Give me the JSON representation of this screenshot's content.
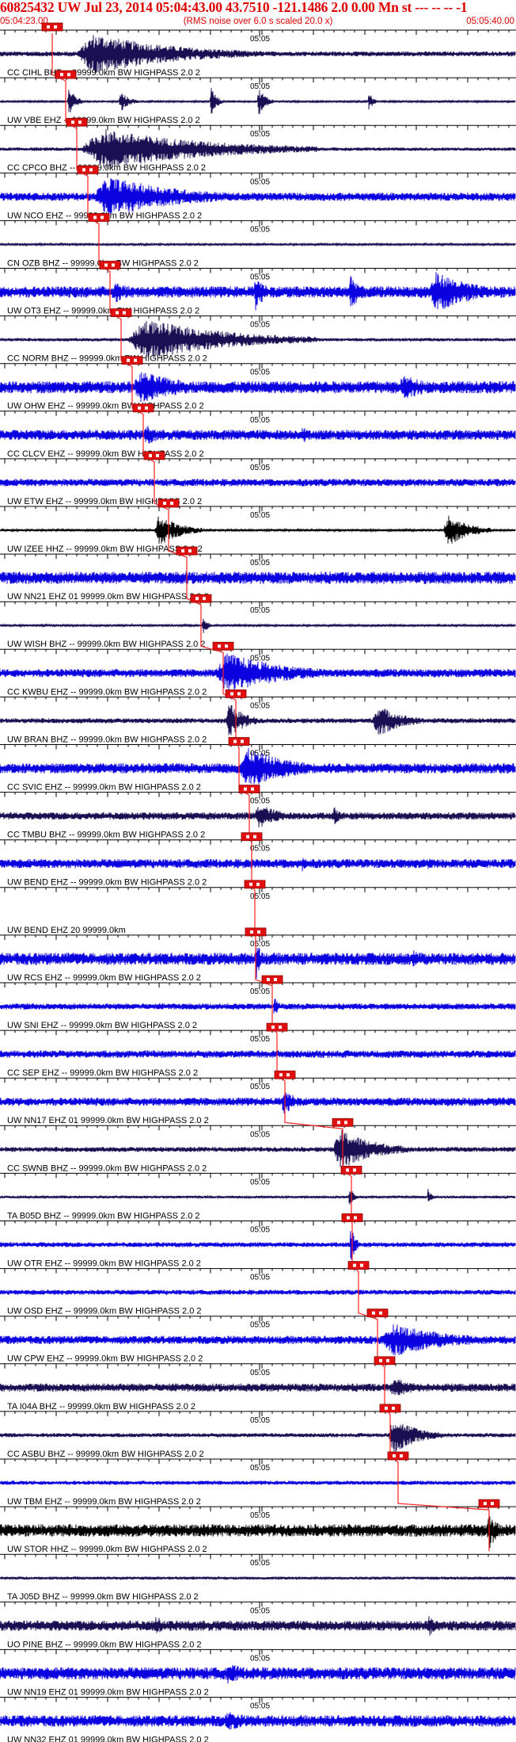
{
  "header": {
    "title": "60825432 UW Jul 23, 2014 05:04:43.00  43.7510 -121.1486  2.0 0.00 Mn st --- -- --  -1",
    "start_time": "05:04:23.00",
    "scaling_note": "(RMS noise over 6.0 s scaled 20.0 x)",
    "end_time": "05:05:40.00"
  },
  "colors": {
    "header_text": "#e00000",
    "pick_line": "#ff2020",
    "pick_box": "#e01010",
    "trace_dark": "#1a0f52",
    "trace_blue": "#0b00e0",
    "trace_black": "#000000",
    "axis": "#000000",
    "label_text": "#000000"
  },
  "chart_data": {
    "type": "seismogram",
    "title": "60825432 UW Jul 23, 2014 05:04:43.00  43.7510 -121.1486  2.0 0.00 Mn st --- -- --  -1",
    "x_start": "05:04:23.00",
    "x_end": "05:05:40.00",
    "x_tick_label": "05:05",
    "traces": [
      {
        "label": "CC CIHL BHZ -- 99999.0km BW  HIGHPASS  2.0  2",
        "color": "dark",
        "noise": 0.12,
        "pick": 66,
        "bursts": [
          [
            95,
            330,
            1.0
          ]
        ]
      },
      {
        "label": "UW VBE EHZ -- 99999.0km BW  HIGHPASS  2.0  2",
        "color": "dark",
        "noise": 0.04,
        "pick": 83,
        "bursts": [
          [
            85,
            105,
            0.7
          ],
          [
            150,
            175,
            0.5
          ],
          [
            265,
            280,
            0.8
          ],
          [
            325,
            345,
            0.7
          ],
          [
            465,
            475,
            0.6
          ]
        ]
      },
      {
        "label": "CC CPCO BHZ -- 99999.0km BW  HIGHPASS  2.0  2",
        "color": "dark",
        "noise": 0.08,
        "pick": 97,
        "bursts": [
          [
            100,
            400,
            1.0
          ]
        ]
      },
      {
        "label": "UW NCO EHZ -- 99999.0km BW  HIGHPASS  2.0  2",
        "color": "blue",
        "noise": 0.2,
        "pick": 111,
        "bursts": [
          [
            115,
            330,
            1.0
          ]
        ]
      },
      {
        "label": "CN OZB BHZ -- 99999.0km BW  HIGHPASS  2.0  2",
        "color": "dark",
        "noise": 0.05,
        "pick": 125,
        "bursts": []
      },
      {
        "label": "UW OT3 EHZ -- 99999.0km BW  HIGHPASS  2.0  2",
        "color": "blue",
        "noise": 0.28,
        "pick": 139,
        "bursts": [
          [
            140,
            190,
            0.6
          ],
          [
            320,
            350,
            0.9
          ],
          [
            440,
            470,
            0.9
          ],
          [
            540,
            652,
            1.0
          ]
        ]
      },
      {
        "label": "CC NORM BHZ -- 99999.0km BW  HIGHPASS  2.0  2",
        "color": "dark",
        "noise": 0.08,
        "pick": 153,
        "bursts": [
          [
            160,
            400,
            1.0
          ]
        ]
      },
      {
        "label": "UW OHW EHZ -- 99999.0km BW  HIGHPASS  2.0  2",
        "color": "blue",
        "noise": 0.3,
        "pick": 167,
        "bursts": [
          [
            165,
            300,
            0.8
          ],
          [
            500,
            600,
            0.6
          ]
        ]
      },
      {
        "label": "CC CLCV EHZ -- 99999.0km BW  HIGHPASS  2.0  2",
        "color": "blue",
        "noise": 0.25,
        "pick": 181,
        "bursts": [
          [
            180,
            230,
            0.5
          ],
          [
            380,
            400,
            0.5
          ]
        ]
      },
      {
        "label": "UW ETW EHZ -- 99999.0km BW  HIGHPASS  2.0  2",
        "color": "blue",
        "noise": 0.18,
        "pick": 195,
        "bursts": []
      },
      {
        "label": "UW IZEE HHZ -- 99999.0km BW  HIGHPASS  2.0  2",
        "color": "black",
        "noise": 0.05,
        "pick": 213,
        "bursts": [
          [
            195,
            255,
            0.8
          ],
          [
            560,
            620,
            0.8
          ]
        ]
      },
      {
        "label": "UW NN21 EHZ 01 99999.0km BW  HIGHPASS  2.0  2",
        "color": "blue",
        "noise": 0.3,
        "pick": 236,
        "bursts": []
      },
      {
        "label": "UW WISH BHZ -- 99999.0km BW  HIGHPASS  2.0  2",
        "color": "dark",
        "noise": 0.05,
        "pick": 254,
        "bursts": [
          [
            255,
            270,
            0.4
          ]
        ]
      },
      {
        "label": "CC KWBU EHZ -- 99999.0km BW  HIGHPASS  2.0  2",
        "color": "blue",
        "noise": 0.2,
        "pick": 282,
        "bursts": [
          [
            270,
            440,
            1.0
          ]
        ]
      },
      {
        "label": "UW BRAN BHZ -- 99999.0km BW  HIGHPASS  2.0  2",
        "color": "dark",
        "noise": 0.12,
        "pick": 298,
        "bursts": [
          [
            285,
            330,
            0.9
          ],
          [
            470,
            540,
            0.8
          ]
        ]
      },
      {
        "label": "CC SVIC EHZ -- 99999.0km BW  HIGHPASS  2.0  2",
        "color": "blue",
        "noise": 0.25,
        "pick": 302,
        "bursts": [
          [
            300,
            430,
            1.0
          ]
        ]
      },
      {
        "label": "CC TMBU BHZ -- 99999.0km BW  HIGHPASS  2.0  2",
        "color": "dark",
        "noise": 0.18,
        "pick": 315,
        "bursts": [
          [
            320,
            390,
            0.6
          ],
          [
            420,
            440,
            0.5
          ]
        ]
      },
      {
        "label": "UW BEND EHZ -- 99999.0km BW  HIGHPASS  2.0  2",
        "color": "blue",
        "noise": 0.22,
        "pick": 318,
        "bursts": [
          [
            380,
            400,
            0.4
          ],
          [
            540,
            555,
            0.4
          ]
        ]
      },
      {
        "label": "UW BEND EHZ 20 99999.0km",
        "color": "blue",
        "noise": 0.0,
        "pick": 322,
        "bursts": []
      },
      {
        "label": "UW RCS EHZ -- 99999.0km BW  HIGHPASS  2.0  2",
        "color": "blue",
        "noise": 0.3,
        "pick": 323,
        "bursts": [
          [
            322,
            340,
            1.0
          ],
          [
            520,
            545,
            0.5
          ]
        ]
      },
      {
        "label": "UW SNI EHZ -- 99999.0km BW  HIGHPASS  2.0  2",
        "color": "blue",
        "noise": 0.15,
        "pick": 344,
        "bursts": [
          [
            345,
            360,
            0.5
          ]
        ]
      },
      {
        "label": "CC SEP EHZ -- 99999.0km BW  HIGHPASS  2.0  2",
        "color": "blue",
        "noise": 0.18,
        "pick": 350,
        "bursts": []
      },
      {
        "label": "UW NN17 EHZ 01 99999.0km BW  HIGHPASS  2.0  2",
        "color": "blue",
        "noise": 0.2,
        "pick": 360,
        "bursts": [
          [
            355,
            390,
            0.7
          ]
        ]
      },
      {
        "label": "CC SWNB BHZ -- 99999.0km BW  HIGHPASS  2.0  2",
        "color": "dark",
        "noise": 0.12,
        "pick": 433,
        "bursts": [
          [
            420,
            520,
            1.0
          ]
        ]
      },
      {
        "label": "TA B05D BHZ -- 99999.0km BW  HIGHPASS  2.0  2",
        "color": "dark",
        "noise": 0.06,
        "pick": 444,
        "bursts": [
          [
            440,
            455,
            0.5
          ],
          [
            540,
            550,
            0.4
          ]
        ]
      },
      {
        "label": "UW OTR EHZ -- 99999.0km BW  HIGHPASS  2.0  2",
        "color": "blue",
        "noise": 0.12,
        "pick": 445,
        "bursts": [
          [
            442,
            455,
            1.0
          ]
        ]
      },
      {
        "label": "UW OSD EHZ -- 99999.0km BW  HIGHPASS  2.0  2",
        "color": "blue",
        "noise": 0.12,
        "pick": 453,
        "bursts": []
      },
      {
        "label": "UW CPW EHZ -- 99999.0km BW  HIGHPASS  2.0  2",
        "color": "blue",
        "noise": 0.2,
        "pick": 477,
        "bursts": [
          [
            480,
            652,
            0.8
          ]
        ]
      },
      {
        "label": "TA I04A BHZ -- 99999.0km BW  HIGHPASS  2.0  2",
        "color": "dark",
        "noise": 0.2,
        "pick": 486,
        "bursts": [
          [
            490,
            560,
            0.5
          ]
        ]
      },
      {
        "label": "CC ASBU BHZ -- 99999.0km BW  HIGHPASS  2.0  2",
        "color": "dark",
        "noise": 0.1,
        "pick": 493,
        "bursts": [
          [
            490,
            560,
            0.9
          ]
        ]
      },
      {
        "label": "UW TBM EHZ -- 99999.0km BW  HIGHPASS  2.0  2",
        "color": "blue",
        "noise": 0.1,
        "pick": 503,
        "bursts": []
      },
      {
        "label": "UW STOR HHZ -- 99999.0km BW  HIGHPASS  2.0  2",
        "color": "black",
        "noise": 0.3,
        "pick": 618,
        "bursts": [
          [
            615,
            640,
            1.0
          ]
        ]
      },
      {
        "label": "TA J05D BHZ -- 99999.0km BW  HIGHPASS  2.0  2",
        "color": "dark",
        "noise": 0.07,
        "pick": null,
        "bursts": []
      },
      {
        "label": "UO PINE BHZ -- 99999.0km BW  HIGHPASS  2.0  2",
        "color": "dark",
        "noise": 0.25,
        "pick": null,
        "bursts": [
          [
            195,
            215,
            0.6
          ],
          [
            540,
            560,
            0.6
          ]
        ]
      },
      {
        "label": "UW NN19 EHZ 01 99999.0km BW  HIGHPASS  2.0  2",
        "color": "blue",
        "noise": 0.3,
        "pick": null,
        "bursts": [
          [
            280,
            360,
            0.5
          ]
        ]
      },
      {
        "label": "UW NN32 EHZ 01 99999.0km BW  HIGHPASS  2.0  2",
        "color": "blue",
        "noise": 0.28,
        "pick": null,
        "bursts": [
          [
            280,
            360,
            0.5
          ]
        ]
      }
    ]
  }
}
